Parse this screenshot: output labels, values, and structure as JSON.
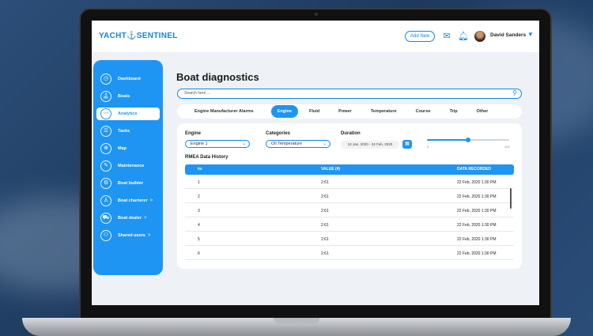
{
  "app": {
    "logo_text": "YACHT⚓SENTINEL",
    "add_new_label": "Add New",
    "user_name": "David Sanders"
  },
  "sidebar": {
    "items": [
      {
        "label": "Dashboard",
        "icon": "dashboard-icon",
        "active": false,
        "chevron": ""
      },
      {
        "label": "Boats",
        "icon": "boat-icon",
        "active": false,
        "chevron": ""
      },
      {
        "label": "Analytics",
        "icon": "analytics-icon",
        "active": true,
        "chevron": ""
      },
      {
        "label": "Tasks",
        "icon": "tasks-icon",
        "active": false,
        "chevron": ""
      },
      {
        "label": "Map",
        "icon": "map-icon",
        "active": false,
        "chevron": ""
      },
      {
        "label": "Maintenance",
        "icon": "wrench-icon",
        "active": false,
        "chevron": ""
      },
      {
        "label": "Boat builder",
        "icon": "builder-icon",
        "active": false,
        "chevron": ""
      },
      {
        "label": "Boat charterer",
        "icon": "charterer-icon",
        "active": false,
        "chevron": ">"
      },
      {
        "label": "Boat dealer",
        "icon": "dealer-icon",
        "active": false,
        "chevron": ">"
      },
      {
        "label": "Shared users",
        "icon": "users-icon",
        "active": false,
        "chevron": ">"
      }
    ]
  },
  "main": {
    "title": "Boat diagnostics",
    "search_placeholder": "Search here ...",
    "tabs": [
      {
        "label": "Engine Manufacturer Alarms",
        "active": false
      },
      {
        "label": "Engine",
        "active": true
      },
      {
        "label": "Fluid",
        "active": false
      },
      {
        "label": "Power",
        "active": false
      },
      {
        "label": "Temperature",
        "active": false
      },
      {
        "label": "Course",
        "active": false
      },
      {
        "label": "Trip",
        "active": false
      },
      {
        "label": "Other",
        "active": false
      }
    ],
    "filters": {
      "engine_label": "Engine",
      "engine_value": "Engine 1",
      "categories_label": "Categories",
      "categories_value": "Oil Temperature",
      "duration_label": "Duration",
      "duration_value": "24 Jan, 2020 - 24 Feb, 2020",
      "slider_min": "0",
      "slider_max": "100",
      "slider_value": 0.5
    },
    "table": {
      "title": "RMEA Data History",
      "headers": [
        "№",
        "VALUE (4)",
        "DATA RECORDED"
      ],
      "rows": [
        {
          "n": "1",
          "value": "2:61",
          "date": "22 Feb, 2020 1:30 PM"
        },
        {
          "n": "2",
          "value": "2:61",
          "date": "22 Feb, 2020 1:30 PM"
        },
        {
          "n": "3",
          "value": "2:61",
          "date": "22 Feb, 2020 1:30 PM"
        },
        {
          "n": "4",
          "value": "2:61",
          "date": "22 Feb, 2020 1:30 PM"
        },
        {
          "n": "5",
          "value": "2:61",
          "date": "22 Feb, 2020 1:30 PM"
        },
        {
          "n": "6",
          "value": "2:61",
          "date": "22 Feb, 2020 1:30 PM"
        }
      ]
    }
  },
  "colors": {
    "accent": "#1e95f2",
    "background": "#1d3a5e"
  }
}
